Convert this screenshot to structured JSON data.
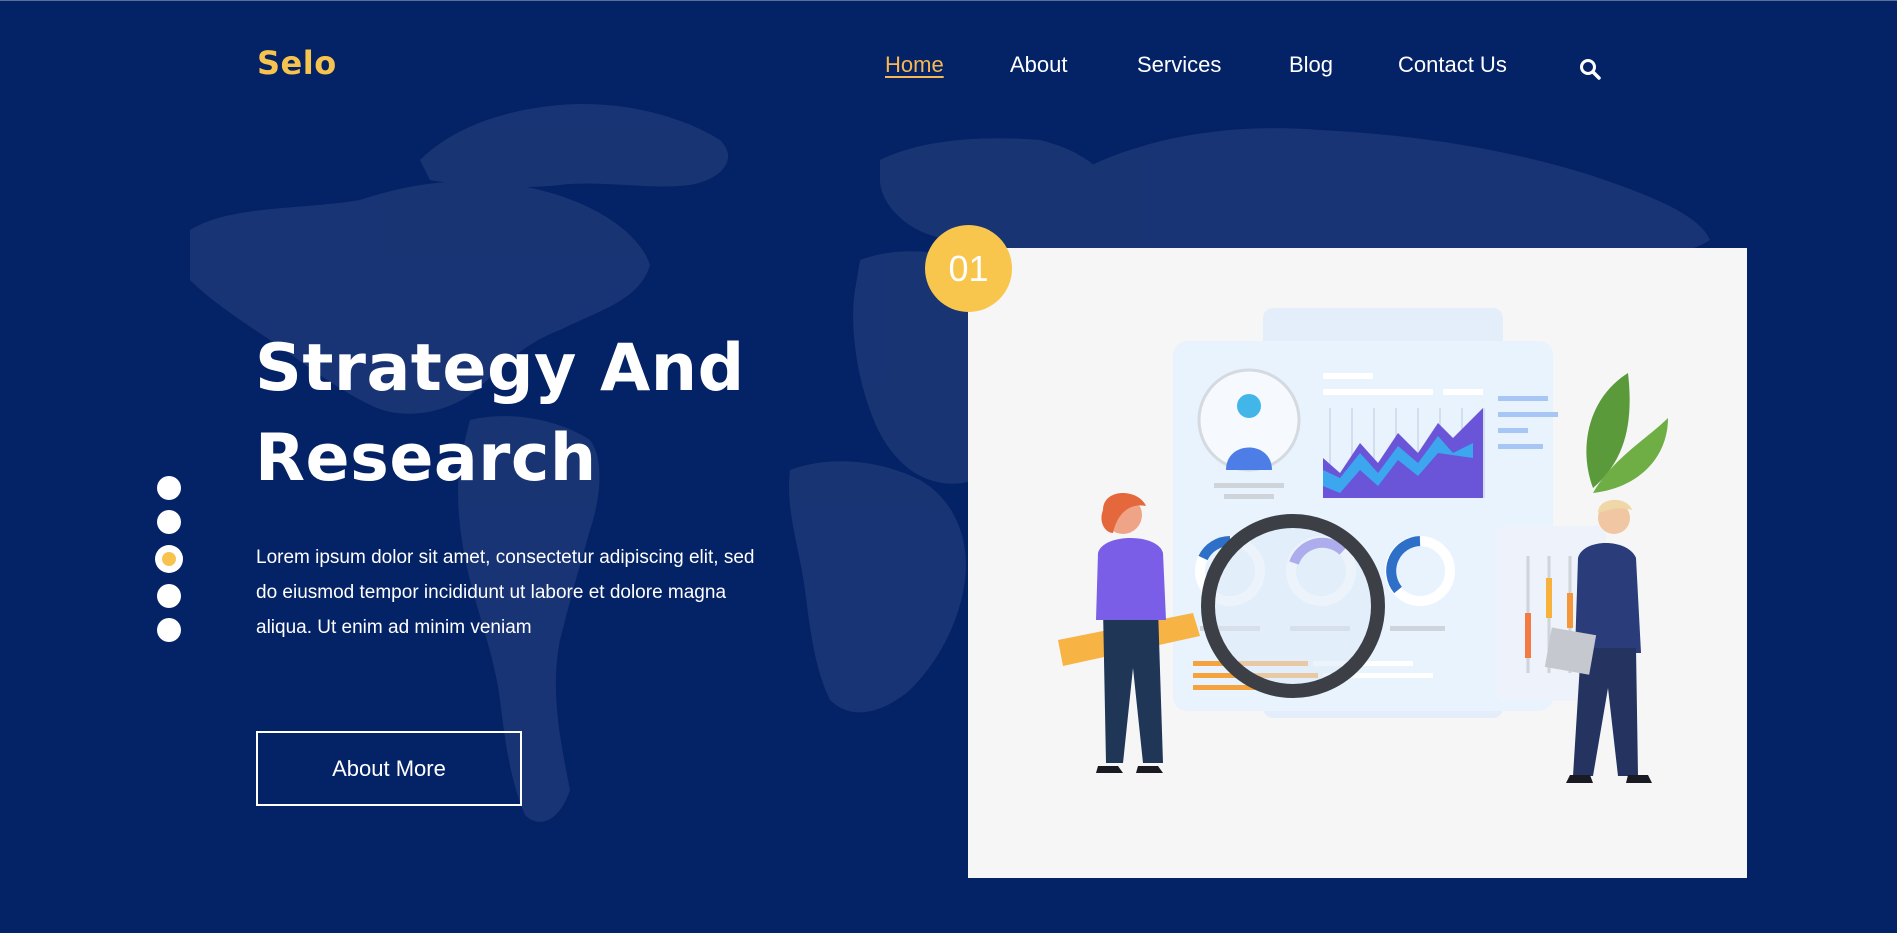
{
  "brand": {
    "logo": "Selo",
    "accent_color": "#f6c34e",
    "background_color": "#042266"
  },
  "nav": {
    "items": [
      {
        "label": "Home",
        "active": true
      },
      {
        "label": "About",
        "active": false
      },
      {
        "label": "Services",
        "active": false
      },
      {
        "label": "Blog",
        "active": false
      },
      {
        "label": "Contact Us",
        "active": false
      }
    ],
    "search_icon": "search-icon"
  },
  "hero": {
    "title_line1": "Strategy And",
    "title_line2": "Research",
    "description_line1": "Lorem ipsum dolor sit amet, consectetur adipiscing elit, sed",
    "description_line2": "do eiusmod tempor incididunt ut labore et dolore magna",
    "description_line3": "aliqua. Ut enim ad minim veniam",
    "cta_label": "About More",
    "slide_number": "01"
  },
  "slider": {
    "count": 5,
    "active_index": 2
  },
  "illustration": {
    "subject": "analytics-dashboard-magnifier-illustration"
  }
}
